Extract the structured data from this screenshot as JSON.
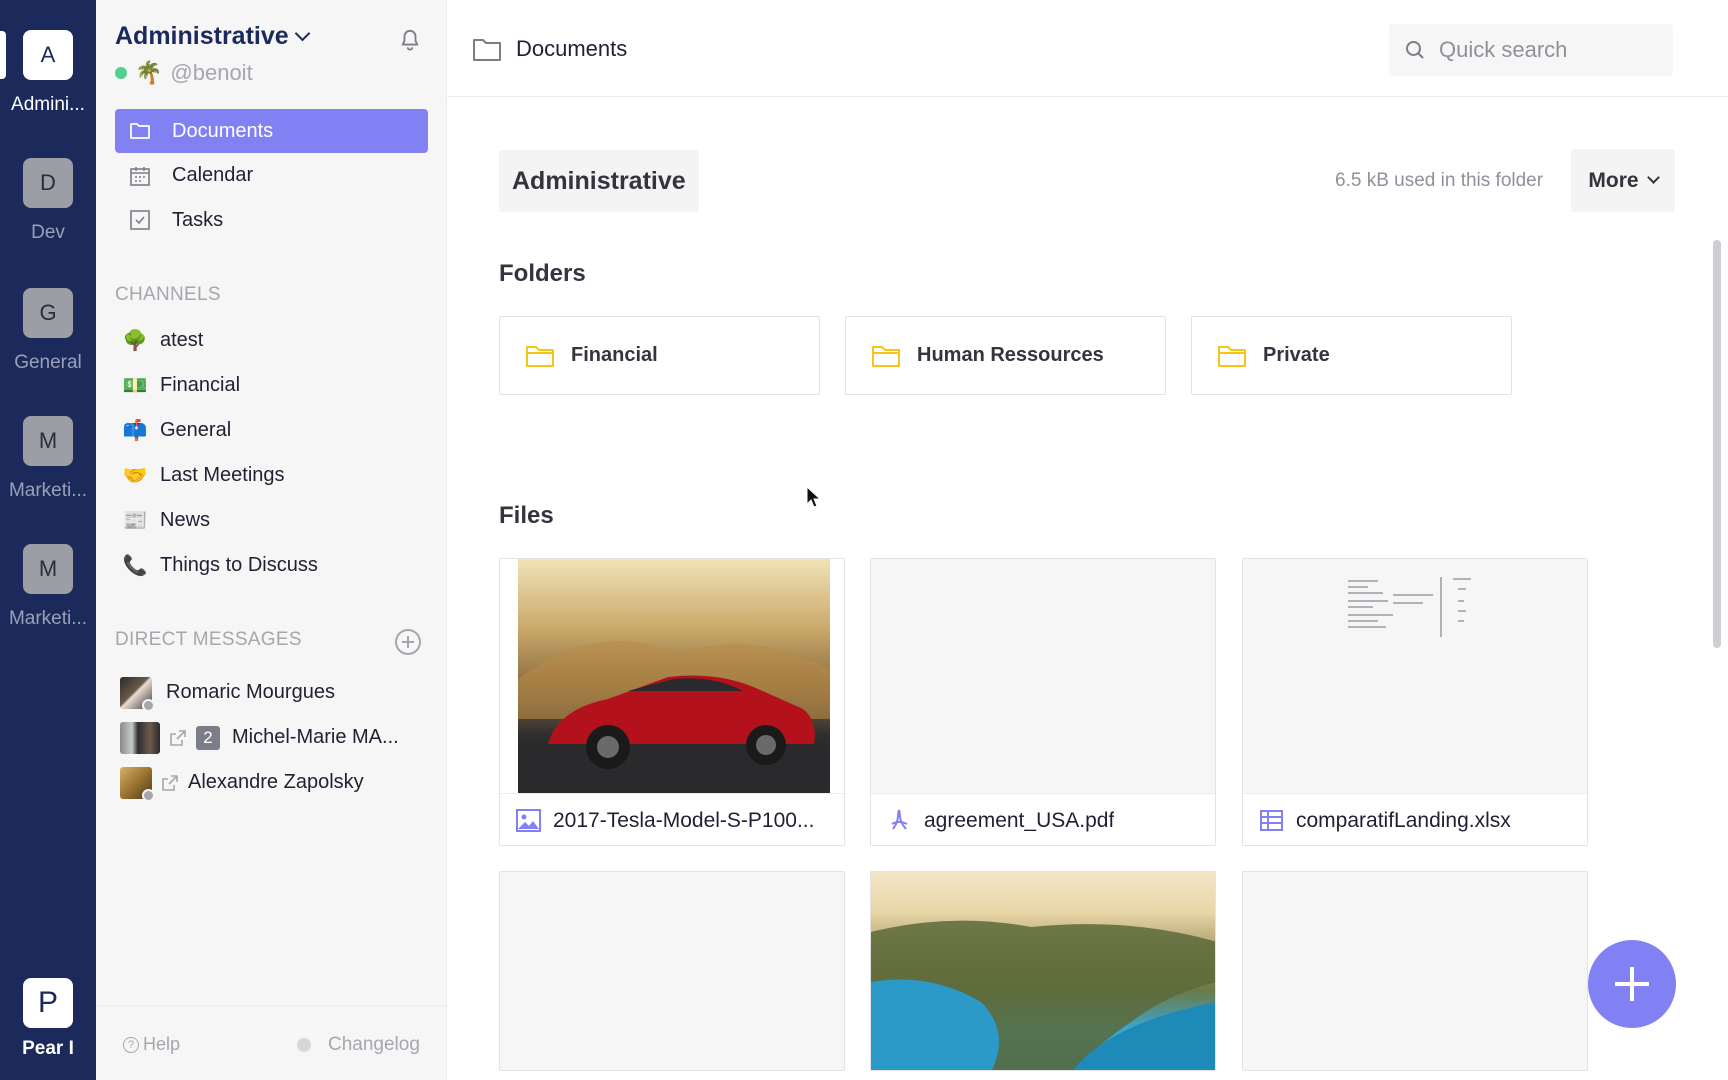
{
  "workspaces": [
    {
      "initial": "A",
      "label": "Admini...",
      "active": true
    },
    {
      "initial": "D",
      "label": "Dev",
      "active": false
    },
    {
      "initial": "G",
      "label": "General",
      "active": false
    },
    {
      "initial": "M",
      "label": "Marketi...",
      "active": false
    },
    {
      "initial": "M",
      "label": "Marketi...",
      "active": false
    }
  ],
  "brand": {
    "initial": "P",
    "label": "Pear I"
  },
  "sidebar": {
    "org_name": "Administrative",
    "user_emoji": "🌴",
    "username": "@benoit",
    "nav": [
      {
        "label": "Documents",
        "icon": "folder-icon",
        "active": true
      },
      {
        "label": "Calendar",
        "icon": "calendar-icon",
        "active": false
      },
      {
        "label": "Tasks",
        "icon": "checkbox-icon",
        "active": false
      }
    ],
    "channels_label": "CHANNELS",
    "channels": [
      {
        "emoji": "🌳",
        "label": "atest"
      },
      {
        "emoji": "💵",
        "label": "Financial"
      },
      {
        "emoji": "📫",
        "label": "General"
      },
      {
        "emoji": "🤝",
        "label": "Last Meetings"
      },
      {
        "emoji": "📰",
        "label": "News"
      },
      {
        "emoji": "📞",
        "label": "Things to Discuss"
      }
    ],
    "dm_label": "DIRECT MESSAGES",
    "dms": [
      {
        "name": "Romaric Mourgues",
        "external": false,
        "count": ""
      },
      {
        "name": "Michel-Marie MA...",
        "external": true,
        "count": "2"
      },
      {
        "name": "Alexandre Zapolsky",
        "external": true,
        "count": ""
      }
    ],
    "help_label": "Help",
    "changelog_label": "Changelog"
  },
  "main": {
    "breadcrumb": "Documents",
    "search_placeholder": "Quick search",
    "folder_title": "Administrative",
    "usage_text": "6.5 kB used in this folder",
    "more_label": "More",
    "folders_heading": "Folders",
    "folders": [
      {
        "label": "Financial"
      },
      {
        "label": "Human Ressources"
      },
      {
        "label": "Private"
      }
    ],
    "files_heading": "Files",
    "files": [
      {
        "name": "2017-Tesla-Model-S-P100...",
        "type": "image",
        "icon": "image-icon"
      },
      {
        "name": "agreement_USA.pdf",
        "type": "pdf",
        "icon": "pdf-icon"
      },
      {
        "name": "comparatifLanding.xlsx",
        "type": "spreadsheet",
        "icon": "spreadsheet-icon"
      }
    ]
  },
  "colors": {
    "rail": "#1b2a5a",
    "accent": "#8181f4",
    "folder_yellow": "#f5c518",
    "online": "#4fd18b"
  }
}
